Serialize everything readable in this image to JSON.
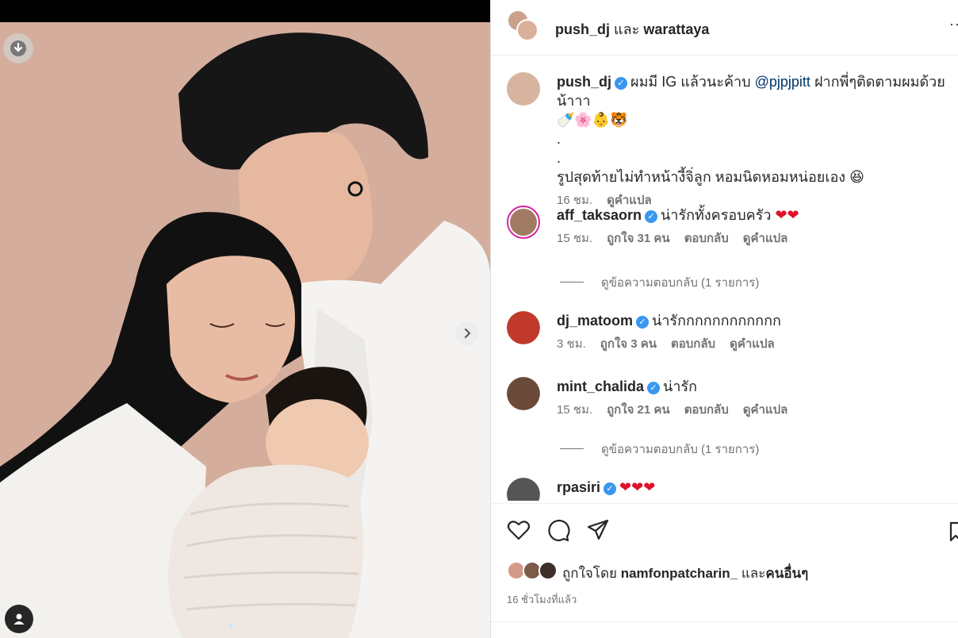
{
  "header": {
    "user1": "push_dj",
    "joiner": "และ",
    "user2": "warattaya",
    "more": "···"
  },
  "caption": {
    "username": "push_dj",
    "text_part1": "ผมมี IG แล้วนะค้าบ",
    "mention": "@pjpjpitt",
    "text_part2": "ฝากพี่ๆติดตามผมด้วยน้าาา",
    "emoji_line": "🍼🌸👶🐯",
    "dot1": ".",
    "dot2": ".",
    "line3": "รูปสุดท้ายไม่ทำหน้างี้จิ่ลูก หอมนิดหอมหน่อยเอง 😆",
    "time": "16 ชม.",
    "translate": "ดูคำแปล"
  },
  "comments": [
    {
      "username": "aff_taksaorn",
      "text": "น่ารักทั้งครอบครัว",
      "hearts": "❤❤",
      "time": "15 ชม.",
      "likes": "ถูกใจ 31 คน",
      "reply": "ตอบกลับ",
      "translate": "ดูคำแปล",
      "avatar_color": "#a07a62"
    },
    {
      "username": "dj_matoom",
      "text": "น่ารักกกกกกกกกกกก",
      "hearts": "",
      "time": "3 ชม.",
      "likes": "ถูกใจ 3 คน",
      "reply": "ตอบกลับ",
      "translate": "ดูคำแปล",
      "avatar_color": "#c0392b"
    },
    {
      "username": "mint_chalida",
      "text": "น่ารัก",
      "hearts": "",
      "time": "15 ชม.",
      "likes": "ถูกใจ 21 คน",
      "reply": "ตอบกลับ",
      "translate": "ดูคำแปล",
      "avatar_color": "#6b4a3a"
    },
    {
      "username": "rpasiri",
      "text": "",
      "hearts": "❤❤❤",
      "avatar_color": "#555555"
    }
  ],
  "view_replies_1": "ดูข้อความตอบกลับ (1 รายการ)",
  "view_replies_2": "ดูข้อความตอบกลับ (1 รายการ)",
  "likes_line": {
    "prefix": "ถูกใจโดย",
    "user": "namfonpatcharin_",
    "joiner": "และ",
    "others": "คนอื่นๆ"
  },
  "posted_time": "16 ชั่วโมงที่แล้ว",
  "colors": {
    "verified": "#3897f0",
    "mention": "#00376b",
    "heart": "#e0112b",
    "secondary_text": "#737373"
  },
  "icons": [
    "download-icon",
    "chevron-right-icon",
    "user-tag-icon",
    "heart-icon",
    "comment-icon",
    "share-icon",
    "bookmark-icon",
    "verified-icon"
  ]
}
